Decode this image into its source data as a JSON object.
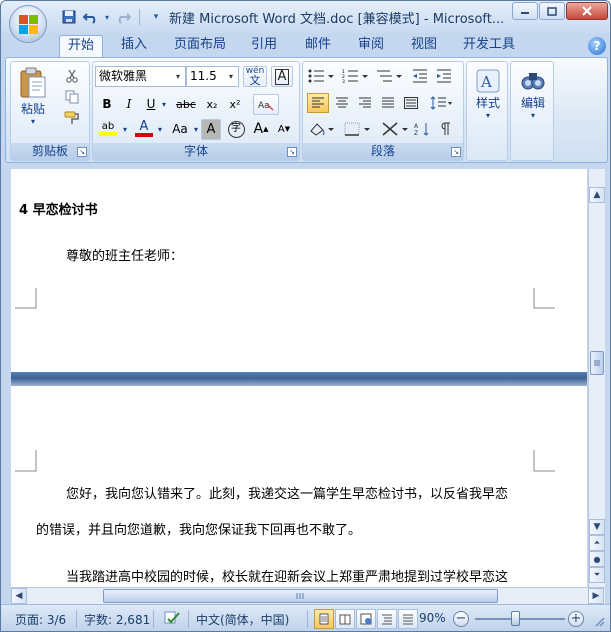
{
  "window": {
    "title": "新建 Microsoft Word 文档.doc [兼容模式] - Microsoft...",
    "controls": [
      "minimize",
      "maximize",
      "close"
    ]
  },
  "quick_access": [
    "save-icon",
    "undo-icon",
    "redo-icon",
    "customize-icon"
  ],
  "tabs": [
    "开始",
    "插入",
    "页面布局",
    "引用",
    "邮件",
    "审阅",
    "视图",
    "开发工具"
  ],
  "active_tab": "开始",
  "ribbon": {
    "clipboard": {
      "title": "剪贴板",
      "paste_label": "粘贴"
    },
    "font": {
      "title": "字体",
      "font_name": "微软雅黑",
      "font_size": "11.5",
      "phonetic_label": "wén",
      "char_border_label": "A",
      "bold": "B",
      "italic": "I",
      "underline": "U",
      "strikethrough": "abc",
      "subscript": "x₂",
      "superscript": "x²",
      "highlight": "ab",
      "font_color": "A",
      "change_case": "Aa",
      "char_shading": "A",
      "enclose": "字",
      "grow": "A",
      "shrink": "A"
    },
    "paragraph": {
      "title": "段落"
    },
    "styles": {
      "label": "样式"
    },
    "editing": {
      "label": "编辑"
    }
  },
  "document": {
    "page1_heading": "4 早恋检讨书",
    "page1_salutation": "尊敬的班主任老师：",
    "page2_line1": "您好，我向您认错来了。此刻，我递交这一篇学生早恋检讨书，以反省我早恋",
    "page2_line2": "的错误，并且向您道歉，我向您保证我下回再也不敢了。",
    "page2_line3": "当我踏进高中校园的时候，校长就在迎新会议上郑重严肃地提到过学校早恋这"
  },
  "status": {
    "page": "页面: 3/6",
    "words": "字数: 2,681",
    "language": "中文(简体，中国)",
    "zoom": "90%",
    "zoom_level_fraction": 0.45
  },
  "colors": {
    "accent": "#15428b",
    "highlight_yellow": "#ffff00",
    "font_color_red": "#e00000"
  }
}
